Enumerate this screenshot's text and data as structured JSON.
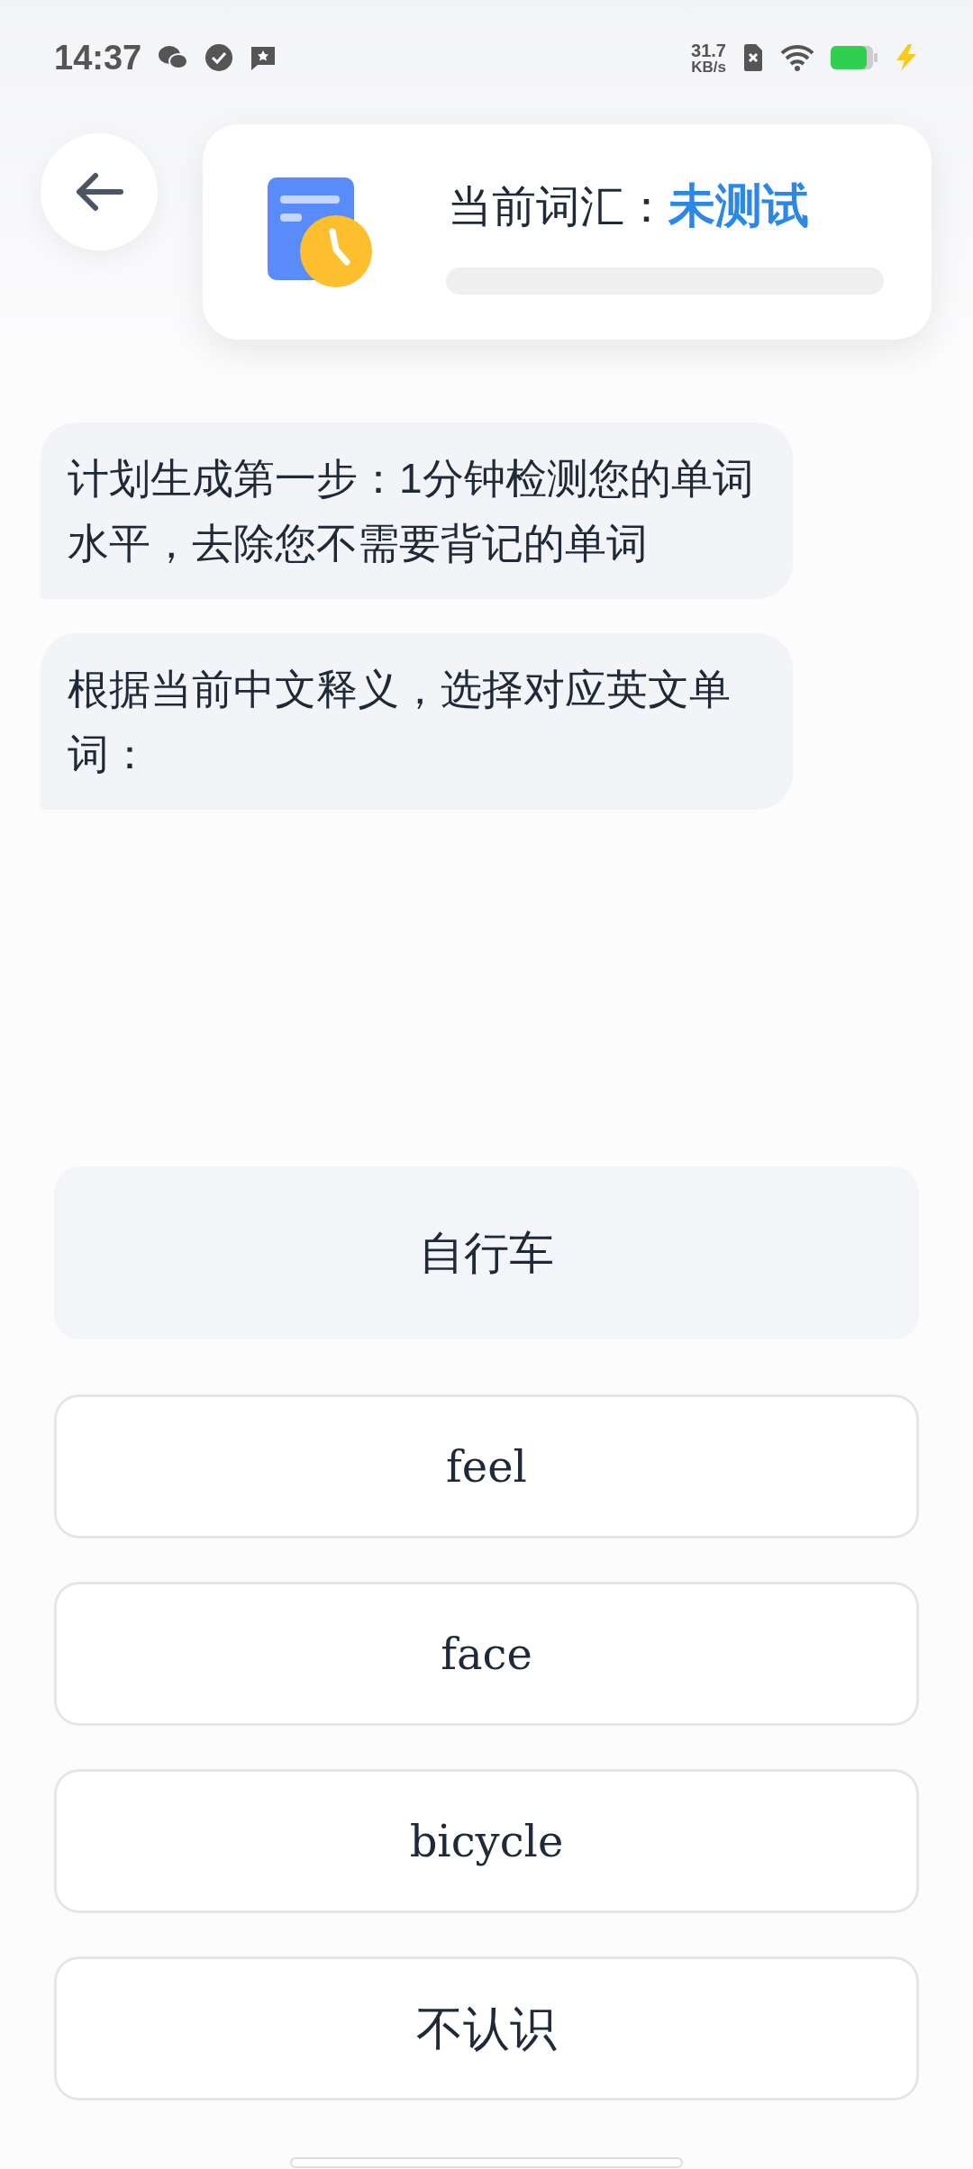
{
  "status_bar": {
    "time": "14:37",
    "speed_value": "31.7",
    "speed_unit": "KB/s"
  },
  "header": {
    "label": "当前词汇：",
    "value": "未测试",
    "progress": {
      "level": 0
    }
  },
  "messages": [
    "计划生成第一步：1分钟检测您的单词水平，去除您不需要背记的单词",
    "根据当前中文释义，选择对应英文单词："
  ],
  "prompt": "自行车",
  "options": [
    {
      "label": "feel",
      "kind": "word"
    },
    {
      "label": "face",
      "kind": "word"
    },
    {
      "label": "bicycle",
      "kind": "word"
    },
    {
      "label": "不认识",
      "kind": "unknown"
    }
  ]
}
